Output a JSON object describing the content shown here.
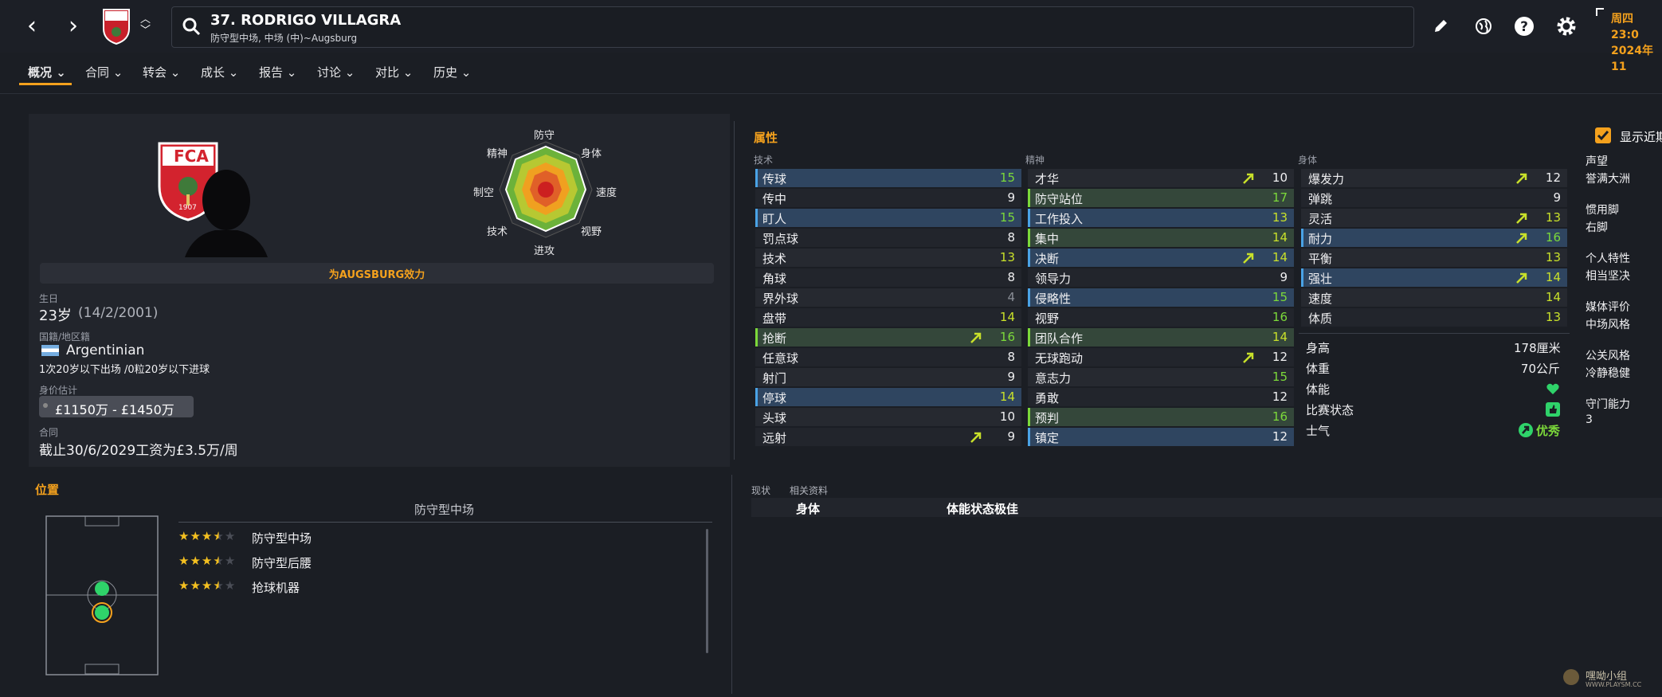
{
  "header": {
    "player_title": "37. RODRIGO VILLAGRA",
    "player_subtitle": "防守型中场, 中场 (中)~Augsburg",
    "club_badge_text": "FCA",
    "date_line1": "周四 23:0",
    "date_line2": "2024年11",
    "icons": [
      "back-icon",
      "forward-icon",
      "club-badge",
      "up-down-icon",
      "search-icon",
      "edit-icon",
      "globe-icon",
      "help-icon",
      "settings-icon"
    ]
  },
  "tabs": [
    {
      "label": "概况",
      "active": true
    },
    {
      "label": "合同"
    },
    {
      "label": "转会"
    },
    {
      "label": "成长"
    },
    {
      "label": "报告"
    },
    {
      "label": "讨论"
    },
    {
      "label": "对比"
    },
    {
      "label": "历史"
    }
  ],
  "profile": {
    "plays_for": "为AUGSBURG效力",
    "dob_label": "生日",
    "age": "23岁",
    "dob": "(14/2/2001)",
    "nationality_label": "国籍/地区籍",
    "nationality": "Argentinian",
    "youth_caps": "1次20岁以下出场 /0粒20岁以下进球",
    "value_label": "身价估计",
    "value": "£1150万 - £1450万",
    "contract_label": "合同",
    "contract": "截止30/6/2029工资为£3.5万/周",
    "badge_year": "1907"
  },
  "radar": {
    "labels": [
      "防守",
      "身体",
      "速度",
      "视野",
      "进攻",
      "技术",
      "制空",
      "精神"
    ]
  },
  "attributes": {
    "title": "属性",
    "technical": {
      "header": "技术",
      "rows": [
        {
          "name": "传球",
          "value": "15",
          "highlight": "blue"
        },
        {
          "name": "传中",
          "value": "9"
        },
        {
          "name": "盯人",
          "value": "15",
          "highlight": "blue"
        },
        {
          "name": "罚点球",
          "value": "8"
        },
        {
          "name": "技术",
          "value": "13"
        },
        {
          "name": "角球",
          "value": "8"
        },
        {
          "name": "界外球",
          "value": "4"
        },
        {
          "name": "盘带",
          "value": "14"
        },
        {
          "name": "抢断",
          "value": "16",
          "highlight": "green",
          "arrow": true
        },
        {
          "name": "任意球",
          "value": "8"
        },
        {
          "name": "射门",
          "value": "9"
        },
        {
          "name": "停球",
          "value": "14",
          "highlight": "blue"
        },
        {
          "name": "头球",
          "value": "10"
        },
        {
          "name": "远射",
          "value": "9",
          "arrow": true
        }
      ]
    },
    "mental": {
      "header": "精神",
      "rows": [
        {
          "name": "才华",
          "value": "10",
          "arrow": true
        },
        {
          "name": "防守站位",
          "value": "17",
          "highlight": "green"
        },
        {
          "name": "工作投入",
          "value": "13",
          "highlight": "blue"
        },
        {
          "name": "集中",
          "value": "14",
          "highlight": "green"
        },
        {
          "name": "决断",
          "value": "14",
          "highlight": "blue",
          "arrow": true
        },
        {
          "name": "领导力",
          "value": "9"
        },
        {
          "name": "侵略性",
          "value": "15",
          "highlight": "blue"
        },
        {
          "name": "视野",
          "value": "16"
        },
        {
          "name": "团队合作",
          "value": "14",
          "highlight": "green"
        },
        {
          "name": "无球跑动",
          "value": "12",
          "arrow": true
        },
        {
          "name": "意志力",
          "value": "15"
        },
        {
          "name": "勇敢",
          "value": "12"
        },
        {
          "name": "预判",
          "value": "16",
          "highlight": "green"
        },
        {
          "name": "镇定",
          "value": "12",
          "highlight": "blue"
        }
      ]
    },
    "physical": {
      "header": "身体",
      "rows": [
        {
          "name": "爆发力",
          "value": "12",
          "arrow": true
        },
        {
          "name": "弹跳",
          "value": "9"
        },
        {
          "name": "灵活",
          "value": "13",
          "arrow": true
        },
        {
          "name": "耐力",
          "value": "16",
          "highlight": "blue",
          "arrow": true
        },
        {
          "name": "平衡",
          "value": "13"
        },
        {
          "name": "强壮",
          "value": "14",
          "highlight": "blue",
          "arrow": true
        },
        {
          "name": "速度",
          "value": "14"
        },
        {
          "name": "体质",
          "value": "13"
        }
      ]
    },
    "info": [
      {
        "label": "身高",
        "value": "178厘米"
      },
      {
        "label": "体重",
        "value": "70公斤"
      },
      {
        "label": "体能",
        "value": ""
      },
      {
        "label": "比赛状态",
        "value": ""
      },
      {
        "label": "士气",
        "value": "优秀"
      }
    ]
  },
  "side_info": {
    "show_recent_label": "显示近期",
    "items": [
      {
        "label": "声望",
        "value": "誉满大洲"
      },
      {
        "label": "惯用脚",
        "value": "右脚"
      },
      {
        "label": "个人特性",
        "value": "相当坚决"
      },
      {
        "label": "媒体评价",
        "value": "中场风格"
      },
      {
        "label": "公关风格",
        "value": "冷静稳健"
      },
      {
        "label": "守门能力",
        "value": "3"
      }
    ]
  },
  "positions": {
    "title": "位置",
    "main_position": "防守型中场",
    "rows": [
      {
        "label": "防守型中场",
        "stars": 3.5
      },
      {
        "label": "防守型后腰",
        "stars": 3.5
      },
      {
        "label": "抢球机器",
        "stars": 3.5
      }
    ]
  },
  "status_panel": {
    "tabs": [
      "现状",
      "相关资料"
    ],
    "col1": "身体",
    "col2": "体能状态极佳"
  },
  "watermark": "嘿呦小组",
  "watermark_url": "WWW.PLAYSM.CC",
  "colors": {
    "accent": "#f4a11d",
    "green": "#7cd93a",
    "blue_row": "#2f4560",
    "green_row": "#34473a"
  }
}
